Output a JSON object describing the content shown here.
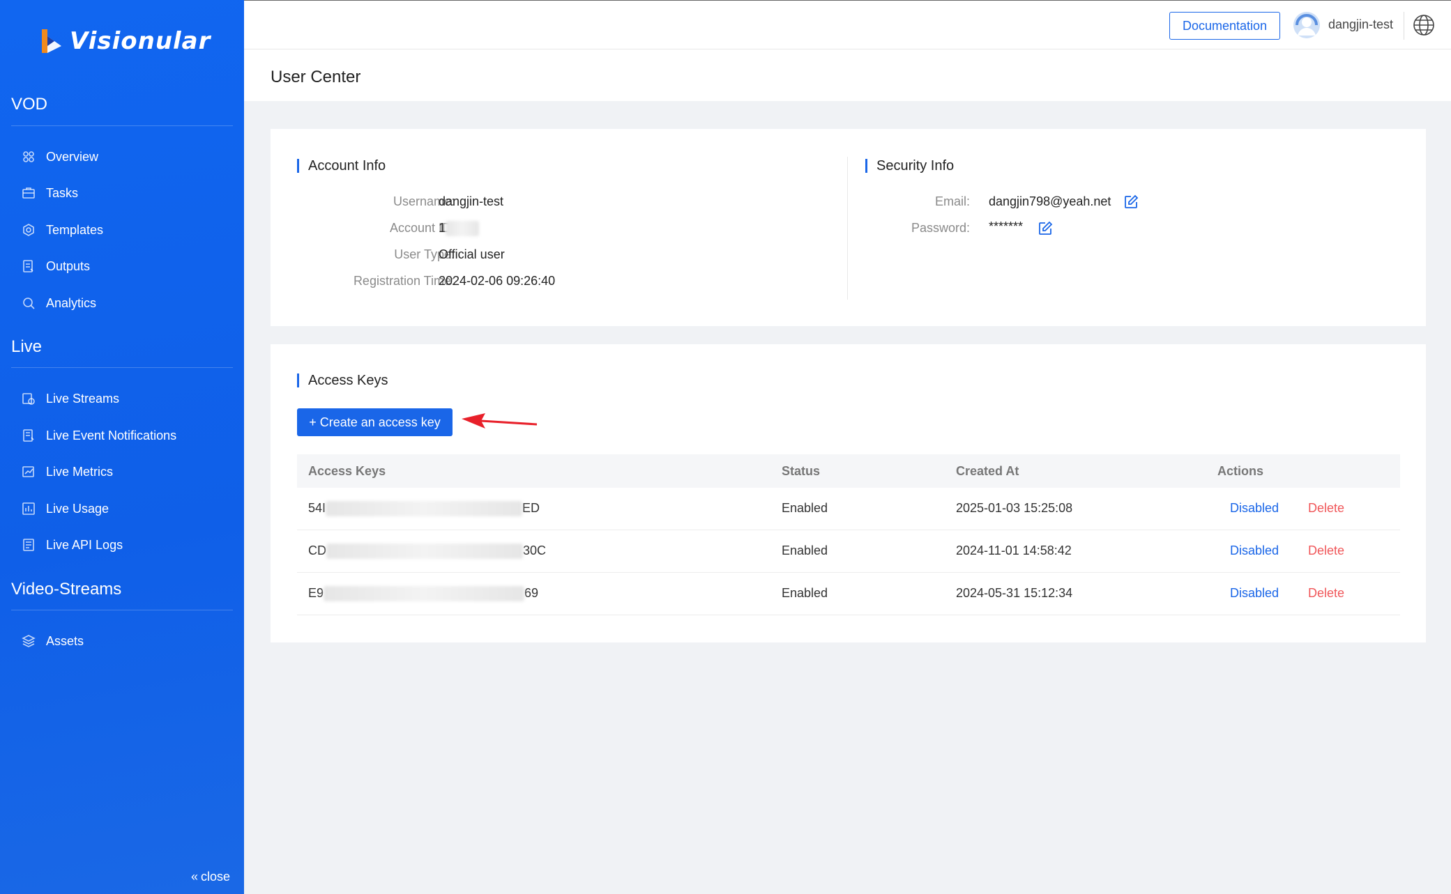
{
  "brand": {
    "name": "Visionular"
  },
  "sidebar": {
    "sections": [
      {
        "title": "VOD",
        "items": [
          "Overview",
          "Tasks",
          "Templates",
          "Outputs",
          "Analytics"
        ]
      },
      {
        "title": "Live",
        "items": [
          "Live Streams",
          "Live Event Notifications",
          "Live Metrics",
          "Live Usage",
          "Live API Logs"
        ]
      },
      {
        "title": "Video-Streams",
        "items": [
          "Assets"
        ]
      }
    ],
    "close_label": "close"
  },
  "topbar": {
    "documentation_label": "Documentation",
    "user_name": "dangjin-test"
  },
  "page": {
    "title": "User Center"
  },
  "account_info": {
    "title": "Account Info",
    "fields": [
      {
        "label": "Username:",
        "value": "dangjin-test"
      },
      {
        "label": "Account ID:",
        "value": "1"
      },
      {
        "label": "User Type:",
        "value": "Official user"
      },
      {
        "label": "Registration Time:",
        "value": "2024-02-06 09:26:40"
      }
    ]
  },
  "security_info": {
    "title": "Security Info",
    "fields": [
      {
        "label": "Email:",
        "value": "dangjin798@yeah.net"
      },
      {
        "label": "Password:",
        "value": "*******"
      }
    ]
  },
  "access_keys": {
    "title": "Access Keys",
    "create_label": "+ Create an access key",
    "columns": [
      "Access Keys",
      "Status",
      "Created At",
      "Actions"
    ],
    "rows": [
      {
        "key_prefix": "54I",
        "key_suffix": "ED",
        "status": "Enabled",
        "created_at": "2025-01-03 15:25:08",
        "action_disable": "Disabled",
        "action_delete": "Delete"
      },
      {
        "key_prefix": "CD",
        "key_suffix": "30C",
        "status": "Enabled",
        "created_at": "2024-11-01 14:58:42",
        "action_disable": "Disabled",
        "action_delete": "Delete"
      },
      {
        "key_prefix": "E9",
        "key_suffix": "69",
        "status": "Enabled",
        "created_at": "2024-05-31 15:12:34",
        "action_disable": "Disabled",
        "action_delete": "Delete"
      }
    ]
  },
  "colors": {
    "primary": "#1a66e8",
    "danger": "#f0575a",
    "arrow": "#e8202a"
  }
}
